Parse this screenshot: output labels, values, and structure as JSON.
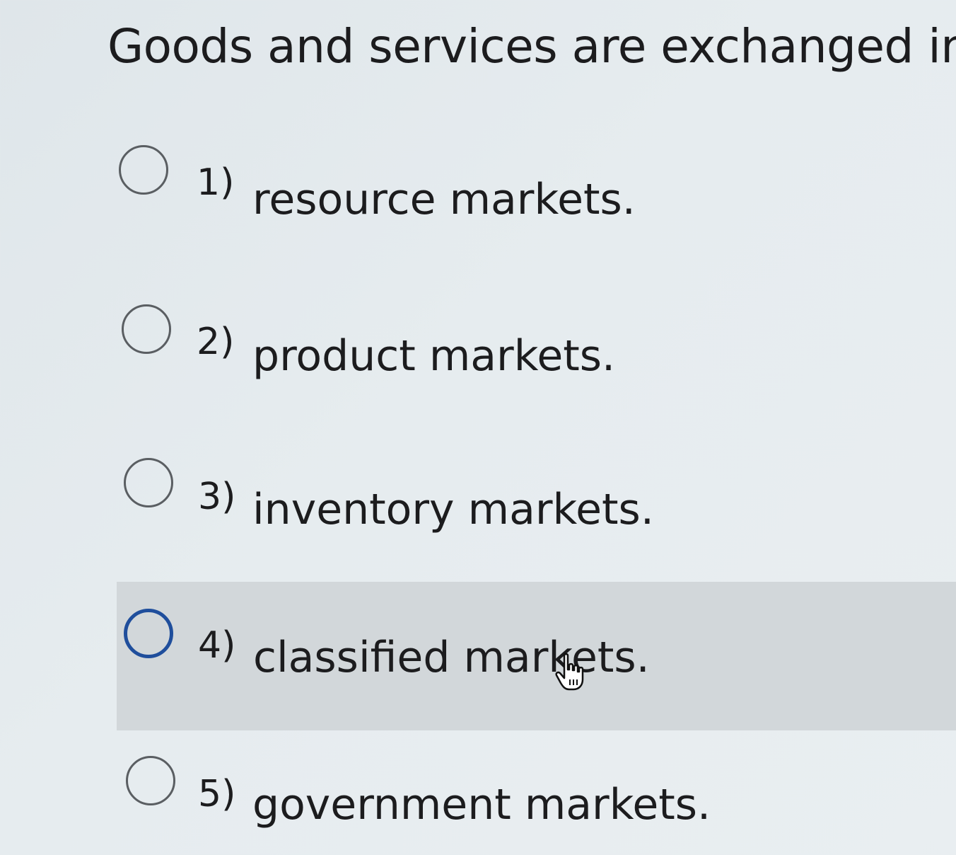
{
  "question": {
    "text": "Goods and services are exchanged in:"
  },
  "options": [
    {
      "number": "1)",
      "text": "resource markets."
    },
    {
      "number": "2)",
      "text": "product markets."
    },
    {
      "number": "3)",
      "text": "inventory markets."
    },
    {
      "number": "4)",
      "text": "classified markets."
    },
    {
      "number": "5)",
      "text": "government markets."
    }
  ],
  "state": {
    "hovered_option": "4)",
    "selected_option": null
  },
  "colors": {
    "background": "#e4eaed",
    "hover_background": "#d2d7da",
    "text": "#1c1c1e",
    "radio_border": "#5a5e62",
    "radio_focus_border": "#1f4e9c"
  },
  "icons": {
    "cursor": "hand-pointer-icon"
  }
}
